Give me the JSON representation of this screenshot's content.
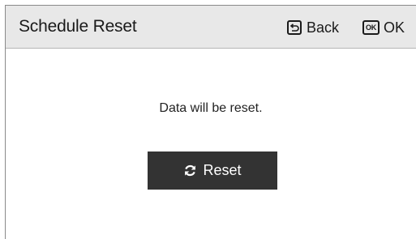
{
  "header": {
    "title": "Schedule Reset",
    "back_label": "Back",
    "ok_key_label": "OK",
    "ok_label": "OK"
  },
  "dialog": {
    "message": "Data will be reset.",
    "reset_label": "Reset"
  },
  "icons": {
    "back": "back-arrow-icon",
    "ok": "ok-key-icon",
    "reset": "refresh-icon"
  },
  "colors": {
    "header_bg": "#e8e8e8",
    "button_bg": "#333333",
    "button_text": "#ffffff"
  }
}
